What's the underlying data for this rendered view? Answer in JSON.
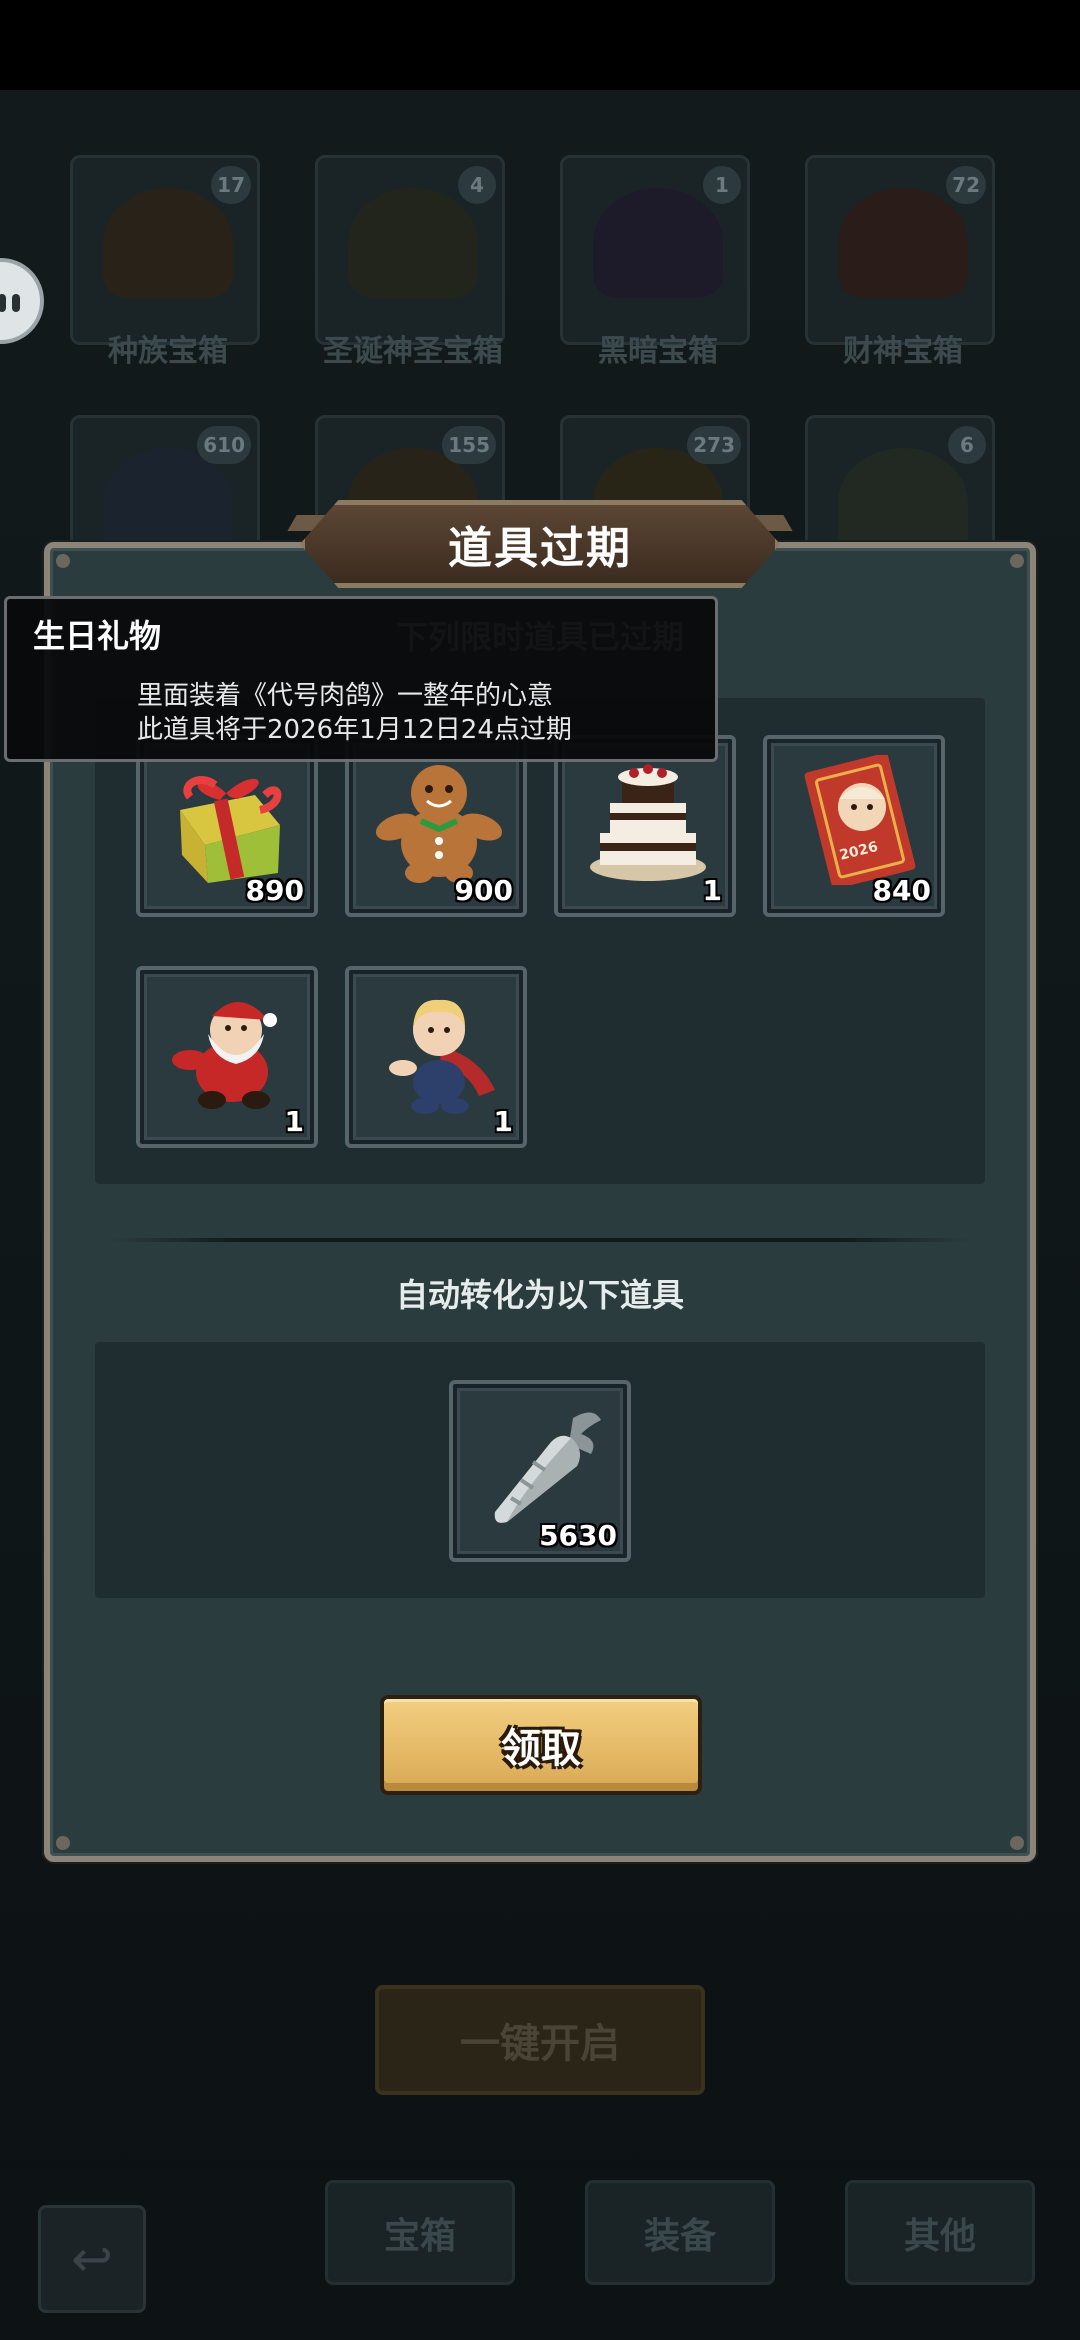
{
  "background": {
    "chests": [
      {
        "name": "种族宝箱",
        "count": "17"
      },
      {
        "name": "圣诞神圣宝箱",
        "count": "4"
      },
      {
        "name": "黑暗宝箱",
        "count": "1"
      },
      {
        "name": "财神宝箱",
        "count": "72"
      },
      {
        "name": "",
        "count": "610"
      },
      {
        "name": "",
        "count": "155"
      },
      {
        "name": "",
        "count": "273"
      },
      {
        "name": "",
        "count": "6"
      }
    ],
    "open_all_label": "一键开启",
    "tabs": [
      "宝箱",
      "装备",
      "其他"
    ]
  },
  "modal": {
    "title": "道具过期",
    "subheading": "下列限时道具已过期",
    "expired_items": [
      {
        "icon": "gift-box-icon",
        "qty": "890"
      },
      {
        "icon": "gingerbread-man-icon",
        "qty": "900"
      },
      {
        "icon": "birthday-cake-icon",
        "qty": "1"
      },
      {
        "icon": "new-year-card-icon",
        "qty": "840"
      },
      {
        "icon": "santa-doll-icon",
        "qty": "1"
      },
      {
        "icon": "hero-doll-icon",
        "qty": "1"
      }
    ],
    "convert_label": "自动转化为以下道具",
    "converted_item": {
      "icon": "silver-carrot-icon",
      "qty": "5630"
    },
    "claim_label": "领取"
  },
  "tooltip": {
    "title": "生日礼物",
    "line1": "里面装着《代号肉鸽》一整年的心意",
    "line2": "此道具将于2026年1月12日24点过期"
  }
}
